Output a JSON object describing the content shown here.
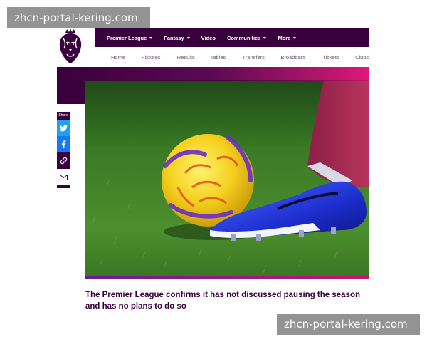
{
  "watermark": {
    "text": "zhcn-portal-kering.com"
  },
  "top_nav": {
    "items": [
      {
        "label": "Premier League",
        "has_dropdown": true
      },
      {
        "label": "Fantasy",
        "has_dropdown": true
      },
      {
        "label": "Video",
        "has_dropdown": false
      },
      {
        "label": "Communities",
        "has_dropdown": true
      },
      {
        "label": "More",
        "has_dropdown": true
      }
    ]
  },
  "sub_nav": {
    "items": [
      "Home",
      "Fixtures",
      "Results",
      "Tables",
      "Transfers",
      "Broadcast",
      "Tickets",
      "Clubs"
    ]
  },
  "share": {
    "label": "Share",
    "icons": [
      "twitter-icon",
      "facebook-icon",
      "link-icon",
      "email-icon"
    ]
  },
  "article": {
    "caption": "The Premier League confirms it has not discussed pausing the season and has no plans to do so"
  },
  "colors": {
    "brand_purple": "#38003c",
    "brand_pink": "#e90052",
    "twitter": "#1da1f2",
    "facebook": "#1877f2"
  }
}
